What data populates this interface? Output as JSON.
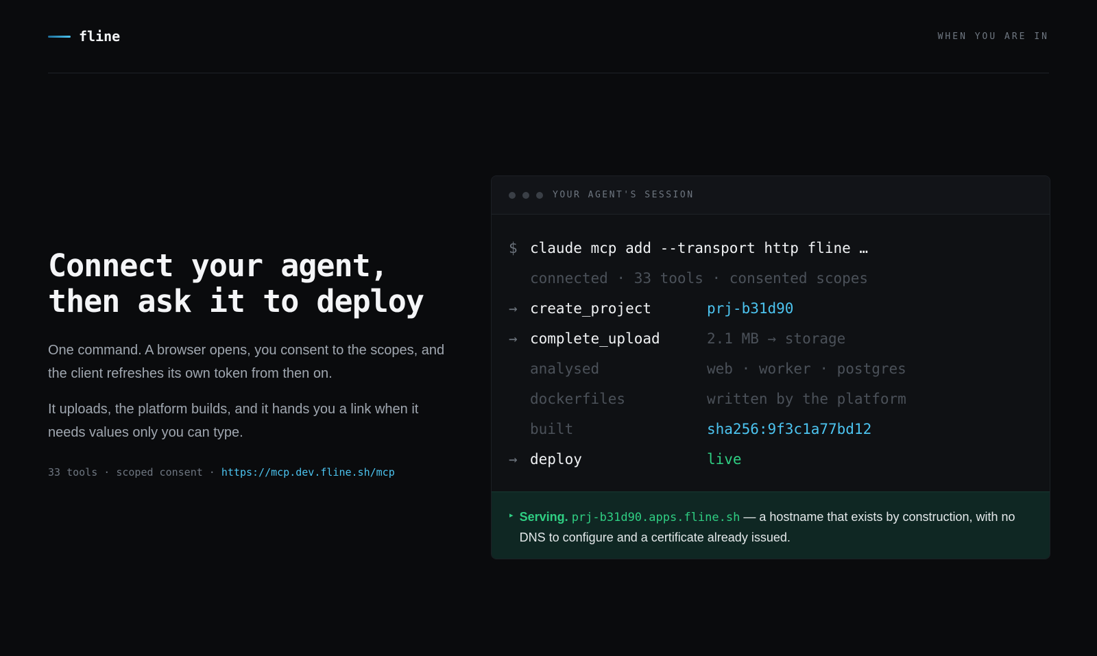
{
  "header": {
    "brand": "fline",
    "right_text": "WHEN YOU ARE IN"
  },
  "hero": {
    "headline_line1": "Connect your agent,",
    "headline_line2": "then ask it to deploy",
    "paragraph1": "One command. A browser opens, you consent to the scopes, and the client refreshes its own token from then on.",
    "paragraph2": "It uploads, the platform builds, and it hands you a link when it needs values only you can type.",
    "meta_tools": "33 tools",
    "meta_sep1": " · ",
    "meta_consent": "scoped consent",
    "meta_sep2": " · ",
    "meta_link": "https://mcp.dev.fline.sh/mcp"
  },
  "session": {
    "title": "YOUR AGENT'S SESSION",
    "command_prompt": "$",
    "command": "claude mcp add --transport http fline …",
    "status_line": "connected · 33 tools · consented scopes",
    "rows": [
      {
        "marker": "→",
        "label": "create_project",
        "value": "prj-b31d90"
      },
      {
        "marker": "→",
        "label": "complete_upload",
        "value": "2.1 MB → storage"
      },
      {
        "marker": "",
        "label": "analysed",
        "value": "web · worker · postgres"
      },
      {
        "marker": "",
        "label": "dockerfiles",
        "value": "written by the platform"
      },
      {
        "marker": "",
        "label": "built",
        "value": "sha256:9f3c1a77bd12"
      },
      {
        "marker": "→",
        "label": "deploy",
        "value": "live"
      }
    ],
    "serving": {
      "marker": "▸",
      "lead": "Serving.",
      "hostname": "prj-b31d90.apps.fline.sh",
      "text": " — a hostname that exists by construction, with no DNS to configure and a certificate already issued."
    }
  },
  "colors": {
    "background": "#0a0b0d",
    "accent_cyan": "#4cc4f0",
    "accent_green": "#2fcf83",
    "serving_bg": "#0f2723"
  }
}
